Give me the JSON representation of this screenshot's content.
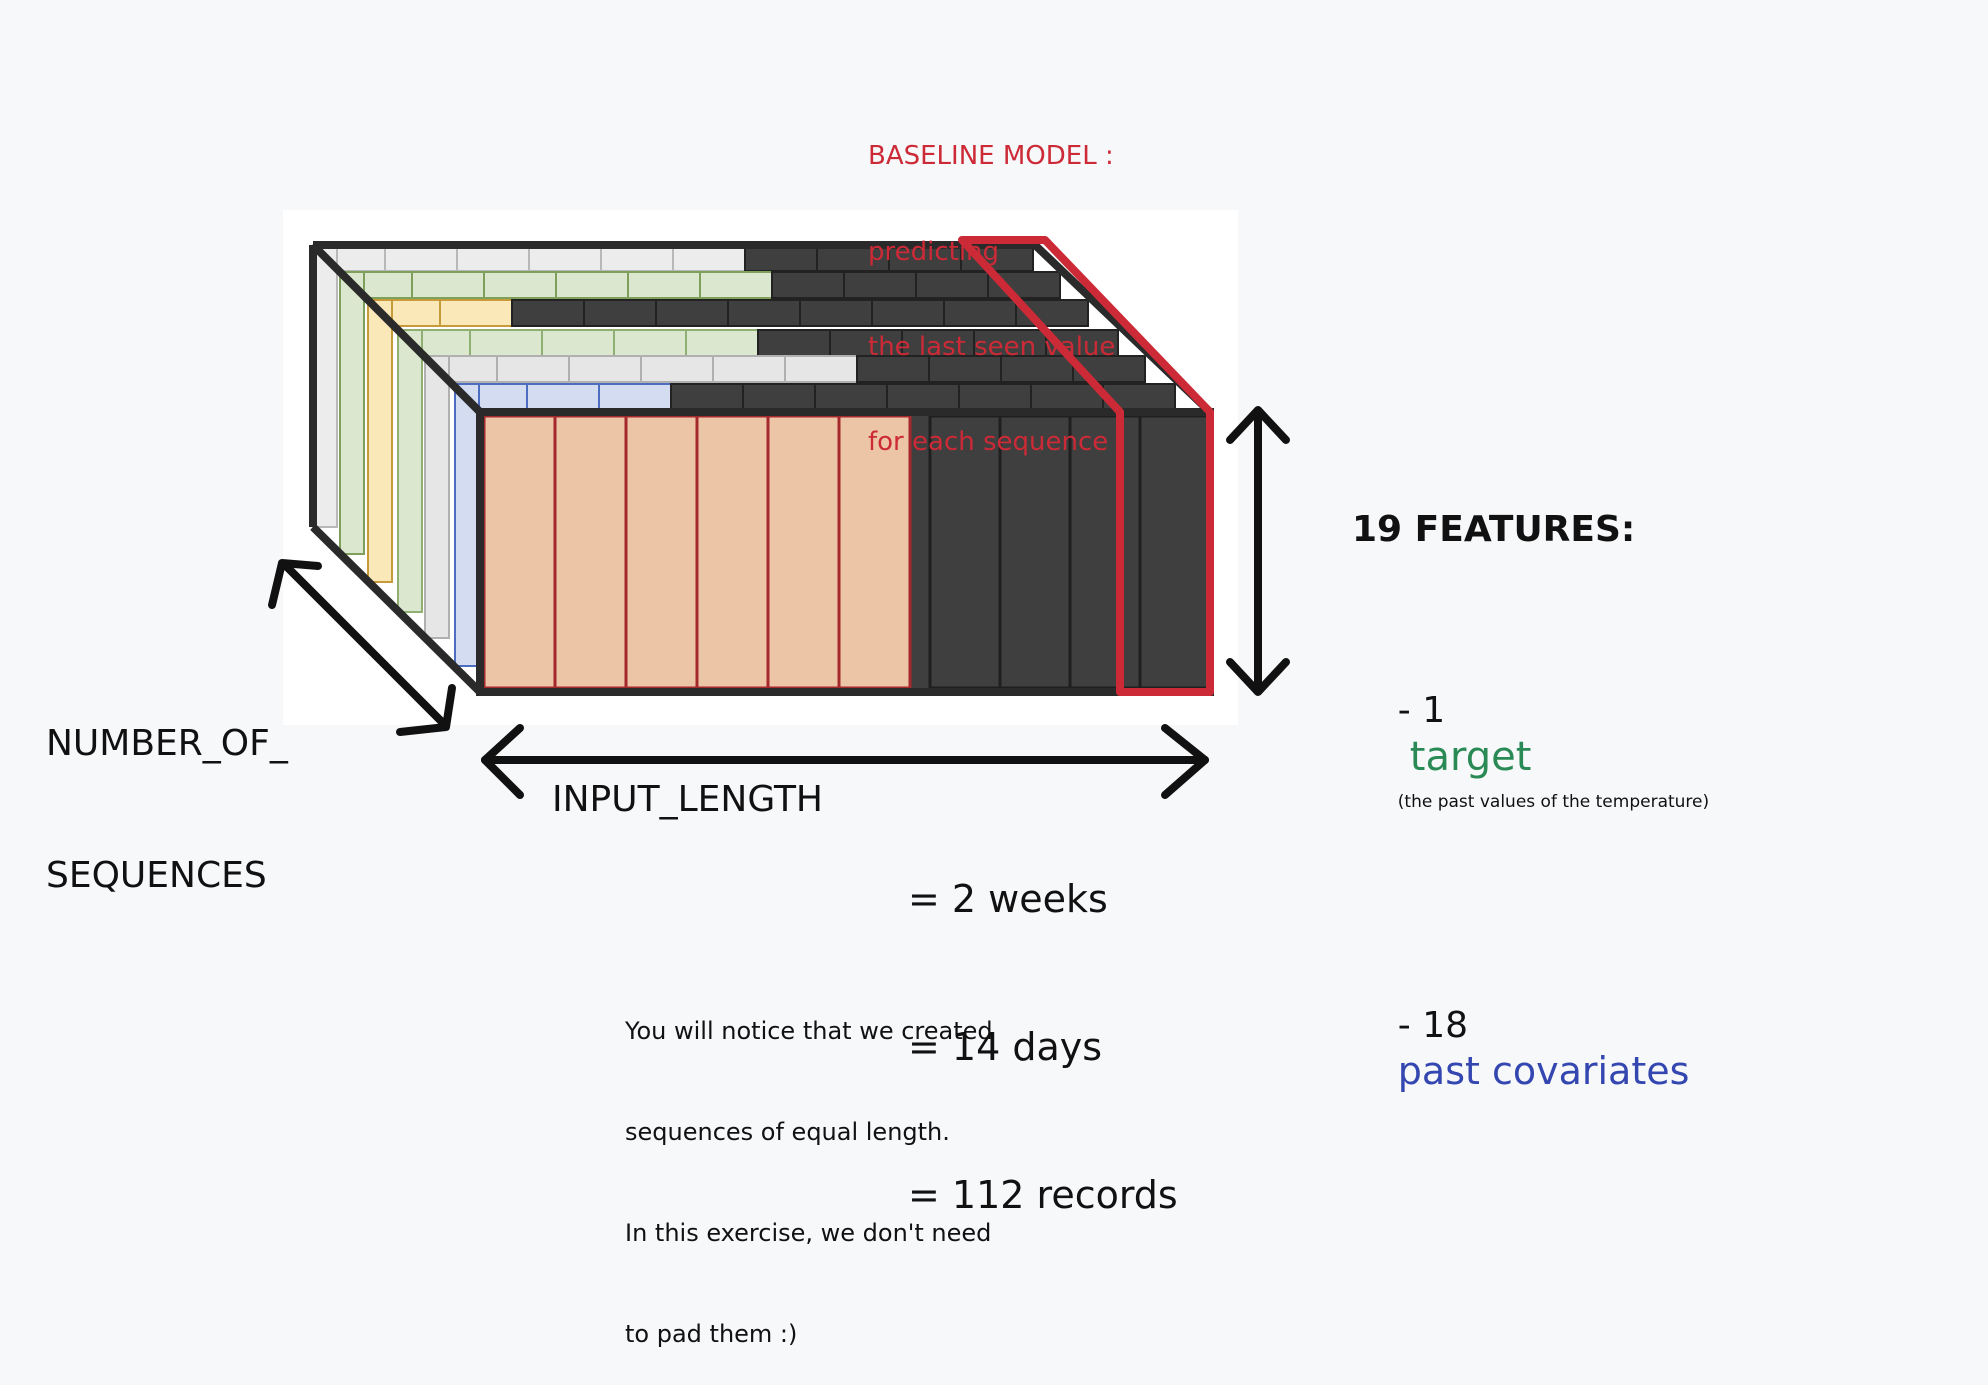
{
  "baseline": {
    "line1": "BASELINE MODEL :",
    "line2": "predicting",
    "line3": "the last seen value",
    "line4": "for each sequence"
  },
  "features": {
    "title": "19 FEATURES:",
    "target_prefix": "- 1",
    "target_word": "target",
    "target_note": "(the past values of the temperature)",
    "covariates_prefix": "- 18",
    "covariates_word": "past covariates"
  },
  "sequences_label": {
    "line1": "NUMBER_OF_",
    "line2": "SEQUENCES"
  },
  "input_length": {
    "label": "INPUT_LENGTH",
    "eq1": "= 2 weeks",
    "eq2": "= 14 days",
    "eq3": "= 112 records"
  },
  "note": {
    "line1": "You will notice that we created",
    "line2": "sequences of equal length.",
    "line3": "In this exercise, we don't need",
    "line4": "to pad them :)"
  },
  "colors": {
    "highlight": "#cc2a36",
    "target_cells": "#ecc4a6",
    "dark_cells": "#3f3f3f",
    "covariate_blue": "#d4dcf2",
    "covariate_green": "#dbe8cf",
    "covariate_yellow": "#fbe8b8"
  }
}
